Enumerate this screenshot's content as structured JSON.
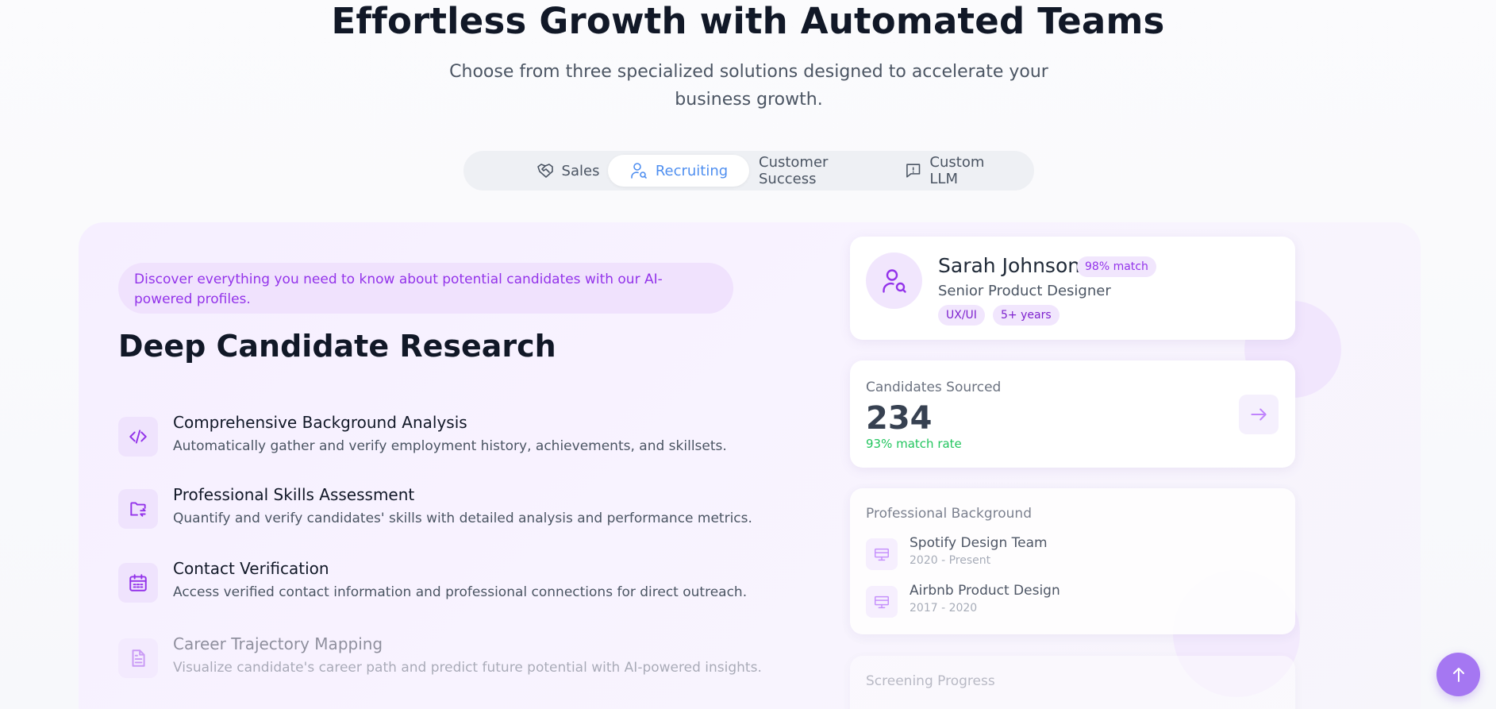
{
  "hero": {
    "title": "Effortless Growth with Automated Teams",
    "subtitle": "Choose from three specialized solutions designed to accelerate your business growth."
  },
  "tabs": [
    {
      "label": "Sales",
      "icon": "handshake-icon",
      "active": false
    },
    {
      "label": "Recruiting",
      "icon": "user-search-icon",
      "active": true
    },
    {
      "label": "Customer Success",
      "icon": "",
      "active": false
    },
    {
      "label": "Custom LLM",
      "icon": "chat-bubble-icon",
      "active": false
    }
  ],
  "section": {
    "promo": "Discover everything you need to know about potential candidates with our AI-powered profiles.",
    "title": "Deep Candidate Research",
    "features": [
      {
        "title": "Comprehensive Background Analysis",
        "description": "Automatically gather and verify employment history, achievements, and skillsets.",
        "icon": "code-icon"
      },
      {
        "title": "Professional Skills Assessment",
        "description": "Quantify and verify candidates' skills with detailed analysis and performance metrics.",
        "icon": "folder-sync-icon"
      },
      {
        "title": "Contact Verification",
        "description": "Access verified contact information and professional connections for direct outreach.",
        "icon": "calendar-icon"
      },
      {
        "title": "Career Trajectory Mapping",
        "description": "Visualize candidate's career path and predict future potential with AI-powered insights.",
        "icon": "document-icon"
      }
    ]
  },
  "profile": {
    "name": "Sarah Johnson",
    "match": "98% match",
    "role": "Senior Product Designer",
    "tags": [
      "UX/UI",
      "5+ years"
    ]
  },
  "stats": {
    "label": "Candidates Sourced",
    "value": "234",
    "sub": "93% match rate"
  },
  "background": {
    "label": "Professional Background",
    "jobs": [
      {
        "title": "Spotify Design Team",
        "dates": "2020 - Present"
      },
      {
        "title": "Airbnb Product Design",
        "dates": "2017 - 2020"
      }
    ]
  },
  "screening": {
    "label": "Screening Progress"
  },
  "colors": {
    "accent": "#9333ea",
    "tab_active": "#4f8ff0",
    "success": "#22c55e",
    "scroll_button": "#a577f2"
  }
}
